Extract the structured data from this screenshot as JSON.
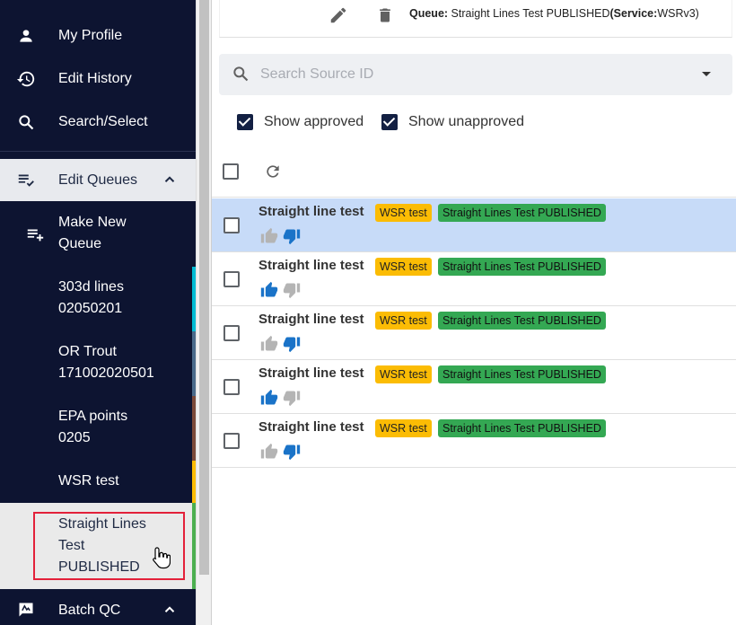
{
  "sidebar": {
    "profile_label": "My Profile",
    "history_label": "Edit History",
    "search_label": "Search/Select",
    "edit_queues_label": "Edit Queues",
    "make_new_queue_label_1": "Make New",
    "make_new_queue_label_2": "Queue",
    "queues": [
      {
        "line1": "303d lines",
        "line2": "02050201",
        "color": "#00bcd4"
      },
      {
        "line1": "OR Trout",
        "line2": "171002020501",
        "color": "#4a6a8a"
      },
      {
        "line1": "EPA points",
        "line2": "0205",
        "color": "#7b4a3a"
      },
      {
        "line1": "WSR test",
        "line2": "",
        "color": "#fbbc04"
      }
    ],
    "selected_queue": {
      "line1": "Straight Lines",
      "line2": "Test",
      "line3": "PUBLISHED",
      "color": "#4caf50"
    },
    "batch_qc_label": "Batch QC"
  },
  "topbar": {
    "queue_prefix": "Queue:",
    "queue_name": " Straight Lines Test PUBLISHED",
    "service_open": "(",
    "service_prefix": "Service:",
    "service_name": "WSRv3)"
  },
  "search": {
    "placeholder": "Search Source ID"
  },
  "filters": {
    "approved_label": "Show approved",
    "unapproved_label": "Show unapproved"
  },
  "rows": [
    {
      "title": "Straight line test",
      "badge_queue": "WSR test",
      "badge_status": "Straight Lines Test PUBLISHED",
      "vote": "down",
      "selected": true
    },
    {
      "title": "Straight line test",
      "badge_queue": "WSR test",
      "badge_status": "Straight Lines Test PUBLISHED",
      "vote": "up",
      "selected": false
    },
    {
      "title": "Straight line test",
      "badge_queue": "WSR test",
      "badge_status": "Straight Lines Test PUBLISHED",
      "vote": "down",
      "selected": false
    },
    {
      "title": "Straight line test",
      "badge_queue": "WSR test",
      "badge_status": "Straight Lines Test PUBLISHED",
      "vote": "up",
      "selected": false
    },
    {
      "title": "Straight line test",
      "badge_queue": "WSR test",
      "badge_status": "Straight Lines Test PUBLISHED",
      "vote": "down",
      "selected": false
    }
  ],
  "colors": {
    "vote_active": "#1a73c8",
    "vote_inactive": "#b4b4b4",
    "sidebar_bg": "#0d1431"
  },
  "icons": [
    "person-icon",
    "history-icon",
    "search-icon",
    "playlist-check-icon",
    "chevron-up-icon",
    "playlist-add-icon",
    "feedback-icon",
    "pencil-icon",
    "trash-icon",
    "dropdown-arrow-icon",
    "refresh-icon",
    "thumb-up-icon",
    "thumb-down-icon"
  ]
}
